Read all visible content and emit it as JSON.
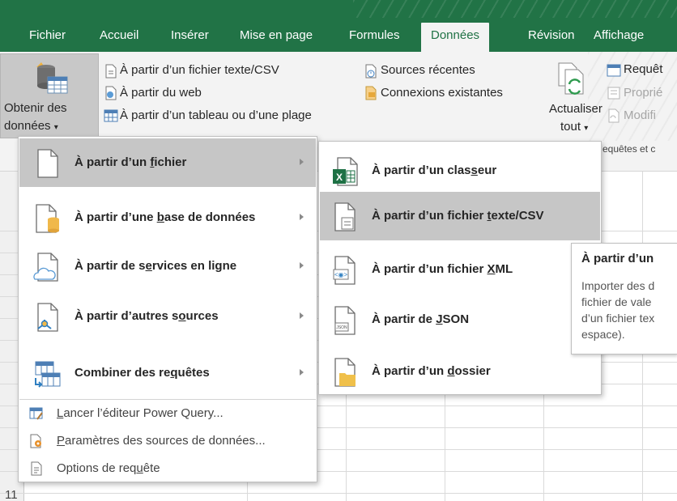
{
  "tabs": [
    {
      "label": "Fichier",
      "active": false
    },
    {
      "label": "Accueil",
      "active": false
    },
    {
      "label": "Insérer",
      "active": false
    },
    {
      "label": "Mise en page",
      "active": false
    },
    {
      "label": "Formules",
      "active": false
    },
    {
      "label": "Données",
      "active": true
    },
    {
      "label": "Révision",
      "active": false
    },
    {
      "label": "Affichage",
      "active": false
    }
  ],
  "ribbon": {
    "obtain_line1": "Obtenir des",
    "obtain_line2": "données",
    "from_text_csv": "À partir d’un fichier texte/CSV",
    "from_web": "À partir du web",
    "from_table": "À partir d’un tableau ou d’une plage",
    "recent_sources": "Sources récentes",
    "existing_connections": "Connexions existantes",
    "refresh_line1": "Actualiser",
    "refresh_line2": "tout",
    "queries": "Requêt",
    "properties": "Proprié",
    "modify": "Modifi",
    "group_label": "equêtes et c"
  },
  "menu": {
    "items": [
      {
        "pre": "À partir d’un ",
        "u": "f",
        "post": "ichier",
        "icon": "file-icon"
      },
      {
        "pre": "À partir d’une ",
        "u": "b",
        "post": "ase de données",
        "icon": "database-file-icon"
      },
      {
        "pre": "À partir de s",
        "u": "e",
        "post": "rvices en ligne",
        "icon": "cloud-file-icon"
      },
      {
        "pre": "À partir d’autres s",
        "u": "o",
        "post": "urces",
        "icon": "connector-file-icon"
      },
      {
        "pre": "Combiner des re",
        "u": "q",
        "post": "uêtes",
        "icon": "combine-queries-icon"
      }
    ],
    "bottom": [
      {
        "pre": "",
        "u": "L",
        "post": "ancer l’éditeur Power Query...",
        "icon": "power-query-editor-icon"
      },
      {
        "pre": "",
        "u": "P",
        "post": "aramètres des sources de données...",
        "icon": "data-source-settings-icon"
      },
      {
        "pre": "Options de req",
        "u": "u",
        "post": "ête",
        "icon": "query-options-icon"
      }
    ]
  },
  "submenu": {
    "items": [
      {
        "pre": "À partir d’un clas",
        "u": "s",
        "post": "eur",
        "icon": "excel-workbook-icon"
      },
      {
        "pre": "À partir d’un fichier ",
        "u": "t",
        "post": "exte/CSV",
        "icon": "text-file-icon"
      },
      {
        "pre": "À partir d’un fichier ",
        "u": "X",
        "post": "ML",
        "icon": "xml-file-icon"
      },
      {
        "pre": "À partir de ",
        "u": "J",
        "post": "SON",
        "icon": "json-file-icon"
      },
      {
        "pre": "À partir d’un ",
        "u": "d",
        "post": "ossier",
        "icon": "folder-icon"
      }
    ]
  },
  "tooltip": {
    "title": "À partir d’un",
    "lines": [
      "Importer des d",
      "fichier de vale",
      "d’un fichier tex",
      "espace)."
    ]
  },
  "sheet": {
    "row_label": "11"
  },
  "colors": {
    "excel_green": "#217346",
    "hover_gray": "#c6c6c6"
  }
}
